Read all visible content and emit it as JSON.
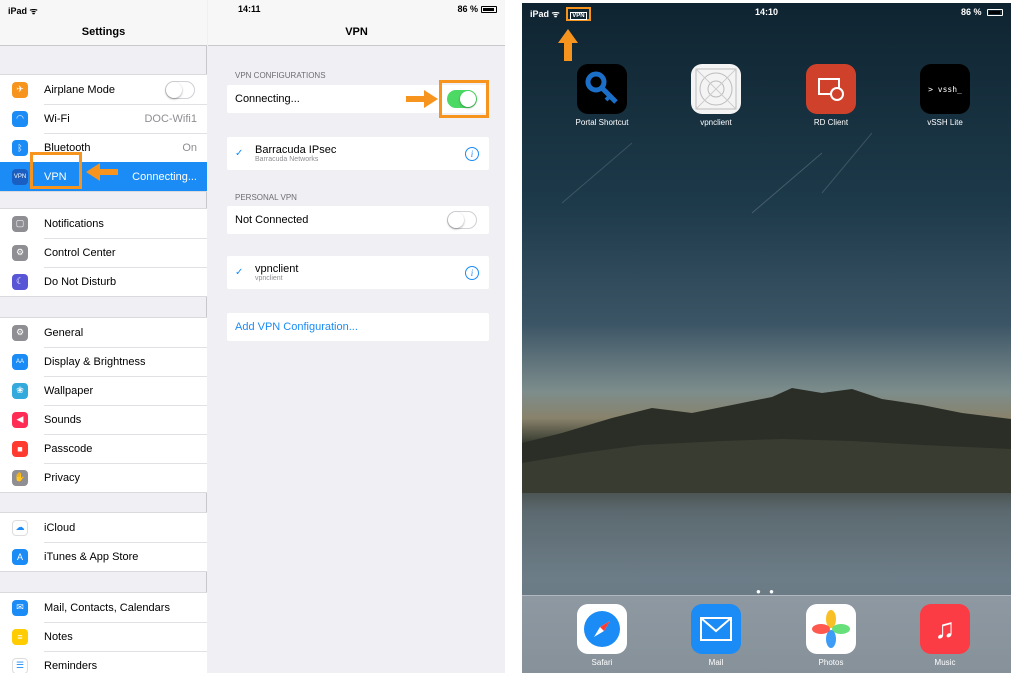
{
  "left_ipad": {
    "status": {
      "carrier": "iPad",
      "time": "14:11",
      "battery": "86 %"
    },
    "master": {
      "title": "Settings",
      "groups": [
        [
          {
            "label": "Airplane Mode",
            "value": "",
            "icon": "airplane-icon",
            "icon_color": "#f7941d",
            "glyph": "✈",
            "toggle": "off"
          },
          {
            "label": "Wi-Fi",
            "value": "DOC-Wifi1",
            "icon": "wifi-icon",
            "icon_color": "#1b8cf5",
            "glyph": "◠"
          },
          {
            "label": "Bluetooth",
            "value": "On",
            "icon": "bluetooth-icon",
            "icon_color": "#1b8cf5",
            "glyph": "ᛒ"
          },
          {
            "label": "VPN",
            "value": "Connecting...",
            "icon": "vpn-icon",
            "icon_color": "#1b5ec1",
            "glyph": "VPN",
            "selected": true
          }
        ],
        [
          {
            "label": "Notifications",
            "icon": "notifications-icon",
            "icon_color": "#8e8e93",
            "glyph": "▢"
          },
          {
            "label": "Control Center",
            "icon": "control-center-icon",
            "icon_color": "#8e8e93",
            "glyph": "⚙"
          },
          {
            "label": "Do Not Disturb",
            "icon": "moon-icon",
            "icon_color": "#5856d6",
            "glyph": "☾"
          }
        ],
        [
          {
            "label": "General",
            "icon": "general-icon",
            "icon_color": "#8e8e93",
            "glyph": "⚙"
          },
          {
            "label": "Display & Brightness",
            "icon": "display-icon",
            "icon_color": "#1b8cf5",
            "glyph": "AA"
          },
          {
            "label": "Wallpaper",
            "icon": "wallpaper-icon",
            "icon_color": "#34aadc",
            "glyph": "❀"
          },
          {
            "label": "Sounds",
            "icon": "sounds-icon",
            "icon_color": "#ff2d55",
            "glyph": "◀"
          },
          {
            "label": "Passcode",
            "icon": "passcode-icon",
            "icon_color": "#ff3b30",
            "glyph": "■"
          },
          {
            "label": "Privacy",
            "icon": "privacy-icon",
            "icon_color": "#8e8e93",
            "glyph": "✋"
          }
        ],
        [
          {
            "label": "iCloud",
            "icon": "icloud-icon",
            "icon_color": "#ffffff",
            "glyph": "☁"
          },
          {
            "label": "iTunes & App Store",
            "icon": "app-store-icon",
            "icon_color": "#1b8cf5",
            "glyph": "A"
          }
        ],
        [
          {
            "label": "Mail, Contacts, Calendars",
            "icon": "mail-icon",
            "icon_color": "#1b8cf5",
            "glyph": "✉"
          },
          {
            "label": "Notes",
            "icon": "notes-icon",
            "icon_color": "#ffcc00",
            "glyph": "≡"
          },
          {
            "label": "Reminders",
            "icon": "reminders-icon",
            "icon_color": "#ffffff",
            "glyph": "☰"
          }
        ]
      ]
    },
    "detail": {
      "title": "VPN",
      "vpn_configurations_header": "VPN CONFIGURATIONS",
      "status_label": "Connecting...",
      "status_toggle": "on",
      "config": {
        "name": "Barracuda IPsec",
        "subtitle": "Barracuda Networks"
      },
      "personal_vpn_header": "PERSONAL VPN",
      "personal_status": "Not Connected",
      "personal_toggle": "off",
      "personal_config": {
        "name": "vpnclient",
        "subtitle": "vpnclient"
      },
      "add_link": "Add VPN Configuration..."
    }
  },
  "right_ipad": {
    "status": {
      "carrier": "iPad",
      "time": "14:10",
      "battery": "86 %",
      "vpn_badge": "VPN"
    },
    "apps": [
      {
        "label": "Portal Shortcut",
        "icon": "key-icon"
      },
      {
        "label": "vpnclient",
        "icon": "vpnclient-icon"
      },
      {
        "label": "RD Client",
        "icon": "rd-client-icon"
      },
      {
        "label": "vSSH Lite",
        "icon": "terminal-icon",
        "glyph": "> vssh_"
      }
    ],
    "dock": [
      {
        "label": "Safari",
        "icon": "safari-icon"
      },
      {
        "label": "Mail",
        "icon": "mail-icon"
      },
      {
        "label": "Photos",
        "icon": "photos-icon"
      },
      {
        "label": "Music",
        "icon": "music-icon"
      }
    ],
    "highlight_color": "#f7941d"
  }
}
